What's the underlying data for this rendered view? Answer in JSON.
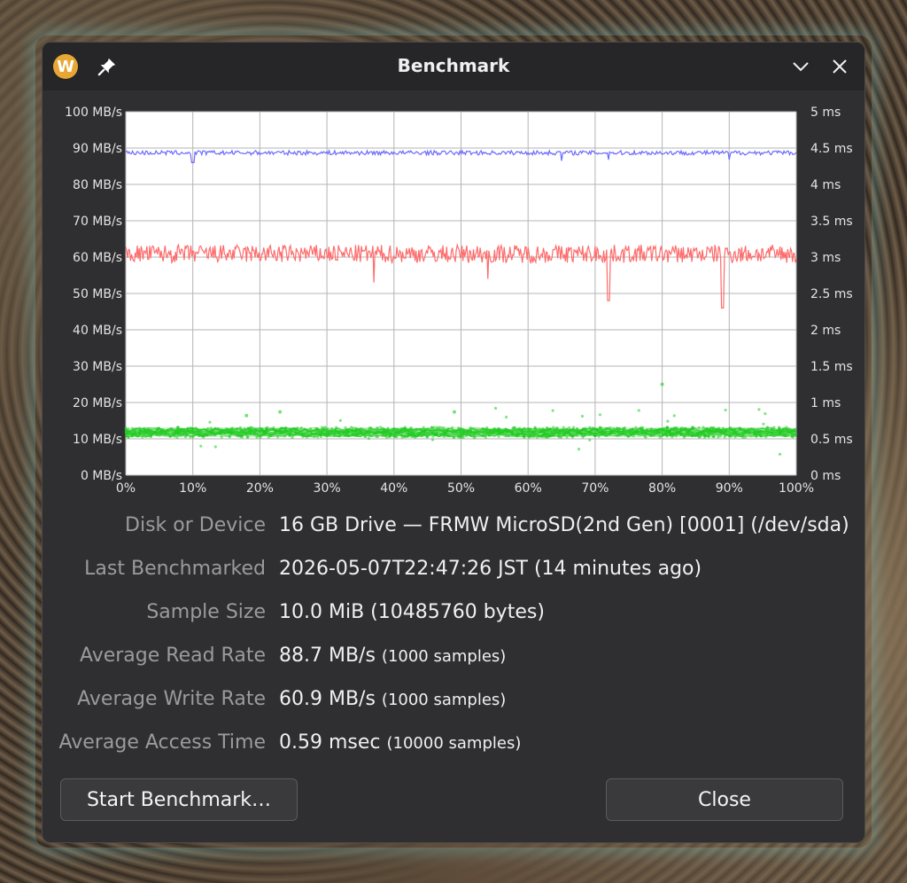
{
  "window": {
    "title": "Benchmark",
    "app_icon_letter": "W"
  },
  "chart_data": {
    "type": "line",
    "x_ticks": [
      "0%",
      "10%",
      "20%",
      "30%",
      "40%",
      "50%",
      "60%",
      "70%",
      "80%",
      "90%",
      "100%"
    ],
    "y_left_ticks": [
      "0 MB/s",
      "10 MB/s",
      "20 MB/s",
      "30 MB/s",
      "40 MB/s",
      "50 MB/s",
      "60 MB/s",
      "70 MB/s",
      "80 MB/s",
      "90 MB/s",
      "100 MB/s"
    ],
    "y_right_ticks": [
      "0 ms",
      "0.5 ms",
      "1 ms",
      "1.5 ms",
      "2 ms",
      "2.5 ms",
      "3 ms",
      "3.5 ms",
      "4 ms",
      "4.5 ms",
      "5 ms"
    ],
    "ylim_left": [
      0,
      100
    ],
    "ylim_right": [
      0,
      5
    ],
    "xlim": [
      0,
      100
    ],
    "grid": true,
    "series": [
      {
        "kind": "read",
        "axis": "left",
        "color": "#6b6bff",
        "mean": 88.7,
        "dips": [
          [
            10,
            86
          ],
          [
            65,
            86.5
          ],
          [
            72,
            86.8
          ],
          [
            90,
            86.8
          ]
        ]
      },
      {
        "kind": "write",
        "axis": "left",
        "color": "#ff6b6b",
        "mean": 60.9,
        "dips": [
          [
            37,
            53
          ],
          [
            54,
            54
          ],
          [
            72,
            48
          ],
          [
            89,
            46
          ]
        ]
      },
      {
        "kind": "access",
        "axis": "right",
        "color": "#22cc22",
        "mean_ms": 0.59
      }
    ]
  },
  "info": [
    {
      "label": "Disk or Device",
      "value": "16 GB Drive — FRMW MicroSD(2nd Gen) [0001] (/dev/sda)",
      "extra": ""
    },
    {
      "label": "Last Benchmarked",
      "value": "2026-05-07T22:47:26 JST (14 minutes ago)",
      "extra": ""
    },
    {
      "label": "Sample Size",
      "value": "10.0 MiB (10485760 bytes)",
      "extra": ""
    },
    {
      "label": "Average Read Rate",
      "value": "88.7 MB/s ",
      "extra": "(1000 samples)"
    },
    {
      "label": "Average Write Rate",
      "value": "60.9 MB/s ",
      "extra": "(1000 samples)"
    },
    {
      "label": "Average Access Time",
      "value": "0.59 msec ",
      "extra": "(10000 samples)"
    }
  ],
  "buttons": {
    "start": "Start Benchmark…",
    "close": "Close"
  }
}
